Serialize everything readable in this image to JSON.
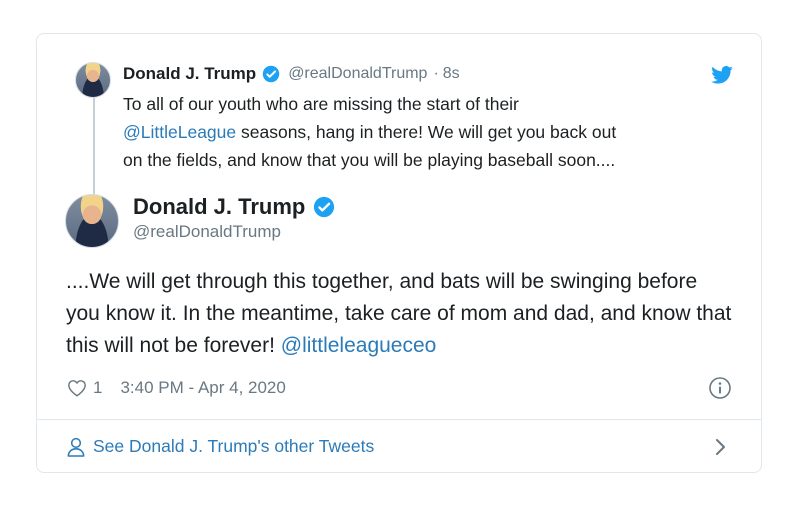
{
  "parent_tweet": {
    "author_name": "Donald J. Trump",
    "handle": "@realDonaldTrump",
    "separator": "·",
    "time": "8s",
    "text_line1": "To all of our youth who are missing the start of their",
    "mention": "@LittleLeague",
    "text_after_mention": " seasons, hang in there! We will get you back out",
    "text_line3": "on the fields, and know that you will be playing baseball soon...."
  },
  "main_tweet": {
    "author_name": "Donald J. Trump",
    "handle": "@realDonaldTrump",
    "text_before_mention": "....We will get through this together, and bats will be swinging before you know it. In the meantime, take care of mom and dad, and know that this will not be forever! ",
    "mention": "@littleleagueceo",
    "like_count": "1",
    "timestamp": "3:40 PM - Apr 4, 2020"
  },
  "footer": {
    "see_more_label": "See Donald J. Trump's other Tweets"
  },
  "icons": {
    "verified": "verified-badge-icon",
    "brand": "twitter-bird-icon",
    "like": "heart-icon",
    "info": "info-icon",
    "person": "person-icon",
    "chevron": "chevron-right-icon"
  },
  "colors": {
    "link": "#2b7bb9",
    "verified": "#1da1f2",
    "muted": "#697882",
    "border": "#e1e8ed"
  }
}
